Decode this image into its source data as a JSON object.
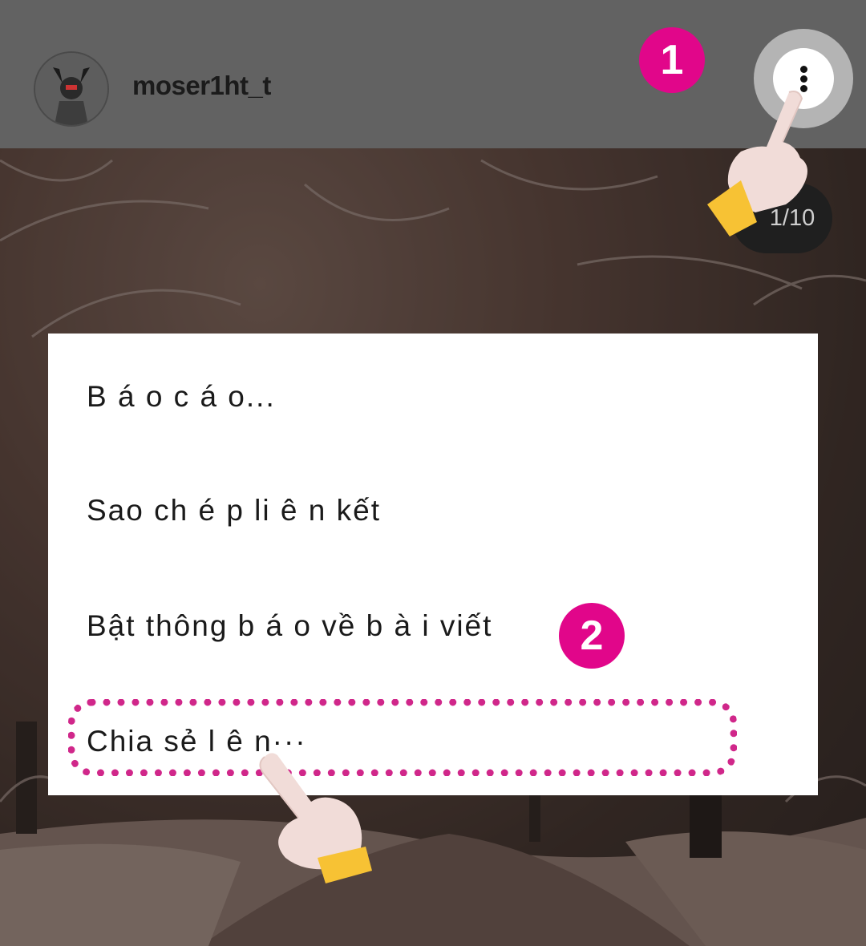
{
  "header": {
    "username": "moser1ht_t",
    "more_icon": "more-vertical-icon"
  },
  "steps": {
    "step1": "1",
    "step2": "2"
  },
  "counter": {
    "text": "1/10"
  },
  "menu": {
    "items": [
      {
        "label": "B á o c á o..."
      },
      {
        "label": "Sao ch é p li ê n kết"
      },
      {
        "label": "Bật thông b á o về b à i viết"
      },
      {
        "label": "Chia sẻ l ê n···"
      }
    ]
  },
  "colors": {
    "accent": "#e1068a",
    "highlight": "#d0278a",
    "header": "#626262",
    "hand_cuff": "#f7c234",
    "hand_skin": "#f1dcd8"
  }
}
